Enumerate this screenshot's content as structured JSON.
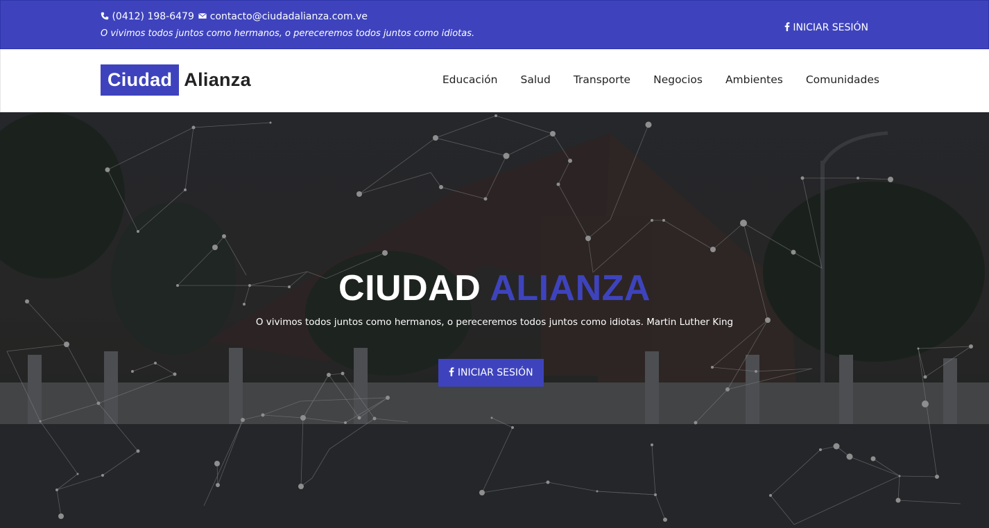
{
  "colors": {
    "brand": "#3e43bd",
    "topbar_text": "#ffffff",
    "nav_text": "#222222",
    "hero_overlay": "#2b2d31"
  },
  "topbar": {
    "phone_icon": "phone-icon",
    "phone": "(0412) 198-6479",
    "email_icon": "envelope-icon",
    "email": "contacto@ciudadalianza.com.ve",
    "tagline": "O vivimos todos juntos como hermanos, o pereceremos todos juntos como idiotas.",
    "login_icon": "facebook-icon",
    "login_label": "INICIAR SESIÓN"
  },
  "logo": {
    "part1": "Ciudad",
    "part2": "Alianza"
  },
  "nav": {
    "items": [
      {
        "label": "Educación"
      },
      {
        "label": "Salud"
      },
      {
        "label": "Transporte"
      },
      {
        "label": "Negocios"
      },
      {
        "label": "Ambientes"
      },
      {
        "label": "Comunidades"
      }
    ]
  },
  "hero": {
    "title_part1": "CIUDAD",
    "title_part2": "ALIANZA",
    "subtitle": "O vivimos todos juntos como hermanos, o pereceremos todos juntos como idiotas. Martin Luther King",
    "button_icon": "facebook-icon",
    "button_label": "INICIAR SESIÓN"
  }
}
